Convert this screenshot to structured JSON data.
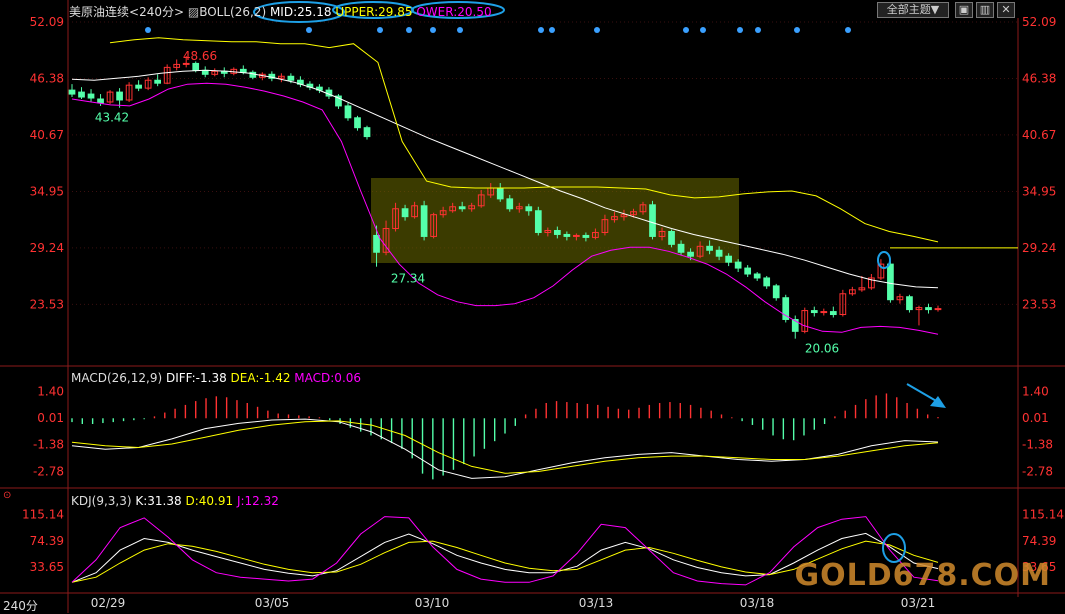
{
  "header": {
    "symbol": "美原油连续",
    "period": "<240分>",
    "boll_label": "BOLL(26,2)",
    "mid": "MID:25.18",
    "upper": "UPPER:29.85",
    "lower": "OWER:20.50",
    "theme_button": "全部主题▼",
    "window_controls": [
      "▣",
      "▥",
      "✕"
    ]
  },
  "macd_header": {
    "label": "MACD(26,12,9)",
    "diff": "DIFF:-1.38",
    "dea": "DEA:-1.42",
    "macd": "MACD:0.06"
  },
  "kdj_header": {
    "label": "KDJ(9,3,3)",
    "k": "K:31.38",
    "d": "D:40.91",
    "j": "J:12.32"
  },
  "period_tag": "240分",
  "watermark": "GOLD678.COM",
  "colors": {
    "up": "#ff3232",
    "down": "#54ffaa",
    "mid": "#ffffff",
    "upper": "#ffff00",
    "lower": "#ff00ff",
    "axis": "#ff3232",
    "box": "#6b6b00",
    "highlight": "#1ea0e6"
  },
  "chart_data": [
    {
      "type": "candlestick",
      "name": "price",
      "y_ticks": [
        "52.09",
        "46.38",
        "40.67",
        "34.95",
        "29.24",
        "23.53"
      ],
      "ylim": [
        17.8,
        52.09
      ],
      "x_ticks": [
        "02/29",
        "03/05",
        "03/10",
        "03/13",
        "03/18",
        "03/21"
      ],
      "annotations": [
        "48.66",
        "43.42",
        "27.34",
        "20.06"
      ],
      "candles": [
        [
          45.2,
          45.8,
          44.8,
          44.5
        ],
        [
          45.0,
          45.5,
          44.5,
          44.3
        ],
        [
          44.8,
          45.3,
          44.4,
          44.0
        ],
        [
          44.3,
          44.8,
          43.9,
          43.6
        ],
        [
          44.0,
          45.2,
          45.0,
          43.8
        ],
        [
          45.0,
          45.4,
          44.2,
          43.42
        ],
        [
          44.2,
          46.0,
          45.7,
          44.0
        ],
        [
          45.7,
          46.2,
          45.4,
          45.1
        ],
        [
          45.4,
          46.5,
          46.2,
          45.2
        ],
        [
          46.2,
          46.8,
          45.9,
          45.6
        ],
        [
          45.9,
          47.8,
          47.5,
          45.8
        ],
        [
          47.5,
          48.3,
          47.8,
          47.2
        ],
        [
          47.8,
          48.66,
          47.9,
          47.5
        ],
        [
          47.9,
          48.1,
          47.2,
          47.0
        ],
        [
          47.2,
          47.6,
          46.8,
          46.5
        ],
        [
          46.8,
          47.4,
          47.1,
          46.6
        ],
        [
          47.1,
          47.5,
          46.9,
          46.5
        ],
        [
          46.9,
          47.5,
          47.3,
          46.7
        ],
        [
          47.3,
          47.7,
          47.0,
          46.8
        ],
        [
          47.0,
          47.2,
          46.5,
          46.3
        ],
        [
          46.5,
          47.0,
          46.8,
          46.2
        ],
        [
          46.8,
          47.1,
          46.4,
          46.1
        ],
        [
          46.4,
          46.9,
          46.6,
          46.0
        ],
        [
          46.6,
          46.9,
          46.2,
          45.9
        ],
        [
          46.2,
          46.6,
          45.8,
          45.5
        ],
        [
          45.8,
          46.1,
          45.5,
          45.2
        ],
        [
          45.5,
          45.8,
          45.2,
          44.9
        ],
        [
          45.2,
          45.5,
          44.6,
          44.3
        ],
        [
          44.6,
          44.8,
          43.6,
          43.3
        ],
        [
          43.6,
          43.9,
          42.4,
          42.1
        ],
        [
          42.4,
          42.6,
          41.4,
          41.1
        ],
        [
          41.4,
          41.6,
          40.5,
          40.2
        ],
        [
          30.5,
          31.5,
          28.8,
          27.34
        ],
        [
          28.8,
          32.0,
          31.2,
          28.5
        ],
        [
          31.2,
          33.8,
          33.2,
          30.9
        ],
        [
          33.2,
          33.6,
          32.4,
          32.0
        ],
        [
          32.4,
          33.9,
          33.5,
          32.2
        ],
        [
          33.5,
          34.0,
          30.4,
          30.0
        ],
        [
          30.4,
          32.8,
          32.6,
          30.2
        ],
        [
          32.6,
          33.4,
          33.0,
          32.3
        ],
        [
          33.0,
          33.8,
          33.4,
          32.8
        ],
        [
          33.4,
          33.9,
          33.2,
          32.9
        ],
        [
          33.2,
          33.8,
          33.5,
          32.9
        ],
        [
          33.5,
          35.1,
          34.6,
          33.3
        ],
        [
          34.6,
          35.8,
          35.3,
          34.3
        ],
        [
          35.3,
          35.8,
          34.2,
          33.9
        ],
        [
          34.2,
          34.6,
          33.2,
          32.9
        ],
        [
          33.2,
          33.8,
          33.4,
          32.8
        ],
        [
          33.4,
          33.7,
          33.0,
          32.5
        ],
        [
          33.0,
          33.4,
          30.8,
          30.5
        ],
        [
          30.8,
          31.3,
          31.0,
          30.4
        ],
        [
          31.0,
          31.4,
          30.6,
          30.2
        ],
        [
          30.6,
          30.9,
          30.4,
          30.0
        ],
        [
          30.4,
          30.7,
          30.5,
          30.0
        ],
        [
          30.5,
          30.8,
          30.3,
          29.9
        ],
        [
          30.3,
          31.2,
          30.8,
          30.1
        ],
        [
          30.8,
          32.6,
          32.1,
          30.5
        ],
        [
          32.1,
          32.9,
          32.4,
          31.8
        ],
        [
          32.4,
          33.1,
          32.6,
          32.0
        ],
        [
          32.6,
          33.2,
          32.9,
          32.3
        ],
        [
          32.9,
          33.9,
          33.6,
          32.6
        ],
        [
          33.6,
          34.0,
          30.4,
          30.1
        ],
        [
          30.4,
          31.3,
          30.9,
          30.0
        ],
        [
          30.9,
          31.1,
          29.6,
          29.3
        ],
        [
          29.6,
          30.0,
          28.8,
          28.5
        ],
        [
          28.8,
          29.2,
          28.4,
          28.0
        ],
        [
          28.4,
          29.9,
          29.4,
          28.2
        ],
        [
          29.4,
          30.0,
          29.0,
          28.6
        ],
        [
          29.0,
          29.4,
          28.4,
          28.0
        ],
        [
          28.4,
          28.7,
          27.8,
          27.4
        ],
        [
          27.8,
          28.1,
          27.2,
          26.8
        ],
        [
          27.2,
          27.5,
          26.6,
          26.3
        ],
        [
          26.6,
          26.8,
          26.2,
          25.9
        ],
        [
          26.2,
          26.4,
          25.4,
          25.1
        ],
        [
          25.4,
          25.6,
          24.2,
          23.9
        ],
        [
          24.2,
          24.5,
          22.0,
          21.7
        ],
        [
          22.0,
          22.4,
          20.8,
          20.06
        ],
        [
          20.8,
          23.2,
          22.9,
          20.6
        ],
        [
          22.9,
          23.3,
          22.7,
          22.3
        ],
        [
          22.7,
          23.1,
          22.8,
          22.4
        ],
        [
          22.8,
          23.3,
          22.5,
          22.2
        ],
        [
          22.5,
          25.0,
          24.6,
          22.3
        ],
        [
          24.6,
          25.3,
          25.0,
          24.4
        ],
        [
          25.0,
          26.4,
          25.2,
          24.8
        ],
        [
          25.2,
          26.6,
          26.2,
          25.0
        ],
        [
          26.2,
          28.1,
          27.6,
          26.0
        ],
        [
          27.6,
          27.9,
          24.0,
          23.7
        ],
        [
          24.0,
          24.6,
          24.3,
          23.6
        ],
        [
          24.3,
          24.5,
          23.0,
          22.7
        ],
        [
          23.0,
          23.4,
          23.2,
          21.4
        ],
        [
          23.2,
          23.6,
          23.0,
          22.6
        ],
        [
          23.0,
          23.4,
          23.1,
          22.8
        ]
      ],
      "series": [
        {
          "name": "MID",
          "values": [
            46.3,
            46.2,
            46.4,
            46.6,
            46.9,
            47.1,
            47.2,
            47.1,
            46.9,
            46.5,
            46.0,
            45.3,
            44.4,
            43.4,
            42.4,
            41.4,
            40.4,
            39.5,
            38.6,
            37.7,
            36.8,
            35.9,
            35.0,
            34.2,
            33.3,
            32.6,
            31.9,
            31.2,
            30.6,
            30.1,
            29.6,
            29.1,
            28.6,
            28.0,
            27.3,
            26.6,
            26.0,
            25.6,
            25.3,
            25.2
          ]
        },
        {
          "name": "UPPER",
          "values": [
            50.0,
            50.3,
            50.5,
            50.3,
            50.2,
            50.1,
            50.1,
            49.9,
            49.9,
            49.5,
            49.9,
            48.0,
            40.0,
            36.0,
            35.4,
            35.3,
            35.3,
            35.3,
            35.4,
            35.4,
            35.4,
            35.3,
            35.2,
            34.6,
            34.3,
            34.4,
            34.7,
            34.9,
            35.0,
            34.5,
            33.2,
            31.7,
            30.9,
            30.4,
            29.85
          ]
        },
        {
          "name": "LOWER",
          "values": [
            44.3,
            44.0,
            43.7,
            43.6,
            44.3,
            45.3,
            45.8,
            45.9,
            45.8,
            45.5,
            45.1,
            44.6,
            44.0,
            43.2,
            40.0,
            35.0,
            30.2,
            27.6,
            25.7,
            24.5,
            23.8,
            23.4,
            23.4,
            23.6,
            24.2,
            25.4,
            27.0,
            28.4,
            29.0,
            29.3,
            29.3,
            28.9,
            28.3,
            27.6,
            26.6,
            25.3,
            23.8,
            22.5,
            21.4,
            20.8,
            20.7,
            21.2,
            21.3,
            21.2,
            20.9,
            20.5
          ]
        }
      ]
    },
    {
      "type": "bar+line",
      "name": "MACD",
      "y_ticks": [
        "1.40",
        "0.01",
        "-1.38",
        "-2.78"
      ],
      "ylim": [
        -3.6,
        1.9
      ],
      "series": [
        {
          "name": "MACD",
          "values": [
            -0.2,
            -0.3,
            -0.3,
            -0.25,
            -0.2,
            -0.15,
            -0.1,
            -0.05,
            0.1,
            0.3,
            0.5,
            0.7,
            0.9,
            1.05,
            1.15,
            1.1,
            0.95,
            0.8,
            0.6,
            0.4,
            0.25,
            0.2,
            0.15,
            0.1,
            0.05,
            -0.1,
            -0.3,
            -0.5,
            -0.7,
            -0.9,
            -1.1,
            -1.3,
            -1.6,
            -2.1,
            -2.9,
            -3.2,
            -3.0,
            -2.7,
            -2.4,
            -2.0,
            -1.6,
            -1.2,
            -0.8,
            -0.4,
            0.2,
            0.5,
            0.8,
            0.9,
            0.85,
            0.8,
            0.75,
            0.7,
            0.6,
            0.5,
            0.45,
            0.55,
            0.7,
            0.8,
            0.85,
            0.8,
            0.7,
            0.55,
            0.4,
            0.2,
            0.05,
            -0.15,
            -0.35,
            -0.6,
            -0.9,
            -1.1,
            -1.15,
            -0.9,
            -0.6,
            -0.3,
            0.1,
            0.4,
            0.7,
            1.0,
            1.2,
            1.3,
            1.1,
            0.8,
            0.5,
            0.2,
            0.06
          ]
        },
        {
          "name": "DIFF",
          "values": [
            -1.6,
            -1.8,
            -1.7,
            -1.2,
            -0.6,
            -0.3,
            -0.1,
            -0.05,
            -0.2,
            -0.8,
            -1.8,
            -3.0,
            -3.5,
            -3.4,
            -3.0,
            -2.6,
            -2.3,
            -2.1,
            -2.0,
            -2.2,
            -2.4,
            -2.5,
            -2.4,
            -2.1,
            -1.6,
            -1.3,
            -1.38
          ]
        },
        {
          "name": "DEA",
          "values": [
            -1.4,
            -1.6,
            -1.7,
            -1.5,
            -1.1,
            -0.7,
            -0.4,
            -0.2,
            -0.15,
            -0.4,
            -1.0,
            -2.0,
            -2.8,
            -3.2,
            -3.1,
            -2.8,
            -2.5,
            -2.3,
            -2.2,
            -2.2,
            -2.3,
            -2.4,
            -2.4,
            -2.2,
            -1.9,
            -1.6,
            -1.42
          ]
        }
      ]
    },
    {
      "type": "line",
      "name": "KDJ",
      "y_ticks": [
        "115.14",
        "74.39",
        "33.65"
      ],
      "ylim": [
        -5,
        130
      ],
      "series": [
        {
          "name": "K",
          "values": [
            10,
            25,
            60,
            78,
            72,
            60,
            50,
            40,
            30,
            24,
            20,
            28,
            50,
            72,
            85,
            70,
            52,
            40,
            30,
            25,
            25,
            35,
            60,
            72,
            62,
            45,
            33,
            25,
            20,
            22,
            40,
            60,
            78,
            86,
            65,
            40,
            31.38
          ]
        },
        {
          "name": "D",
          "values": [
            10,
            18,
            40,
            60,
            70,
            66,
            58,
            48,
            38,
            30,
            25,
            26,
            38,
            56,
            72,
            74,
            64,
            52,
            40,
            32,
            28,
            30,
            45,
            60,
            64,
            55,
            44,
            34,
            26,
            22,
            30,
            46,
            62,
            74,
            68,
            52,
            40.91
          ]
        },
        {
          "name": "J",
          "values": [
            10,
            45,
            95,
            110,
            80,
            45,
            25,
            18,
            15,
            12,
            15,
            40,
            85,
            112,
            110,
            65,
            30,
            15,
            10,
            10,
            20,
            55,
            100,
            95,
            60,
            25,
            12,
            8,
            6,
            25,
            65,
            95,
            108,
            112,
            60,
            18,
            12.32
          ]
        }
      ]
    }
  ]
}
